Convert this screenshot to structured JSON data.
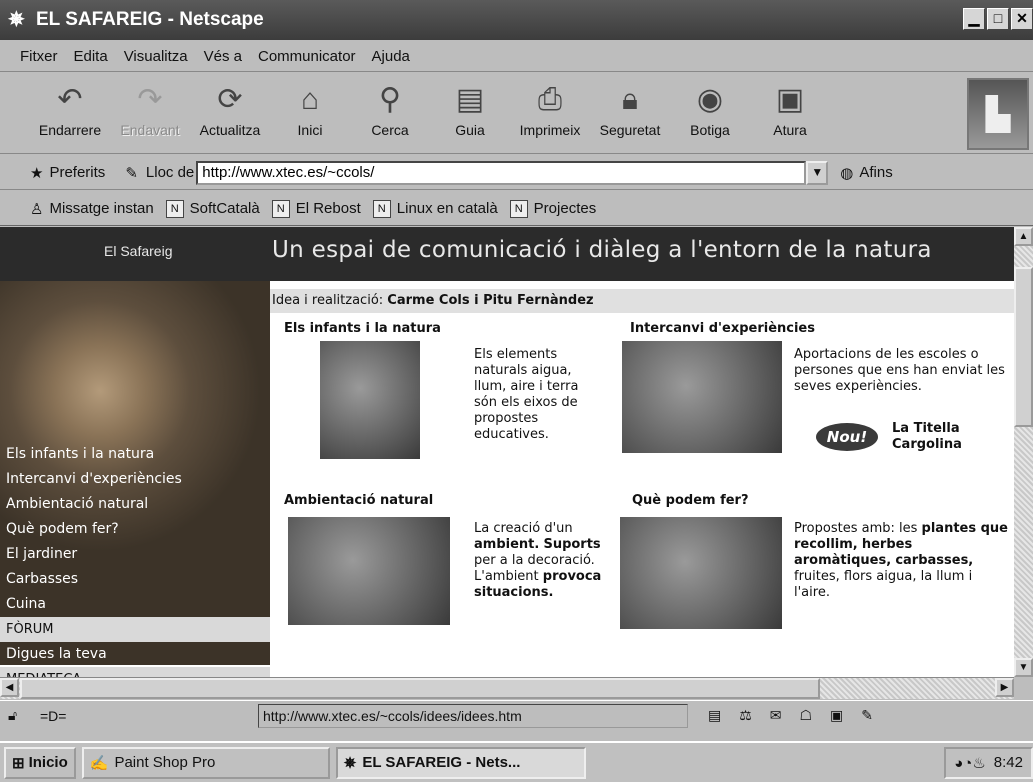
{
  "window": {
    "title": "EL SAFAREIG - Netscape"
  },
  "menu": [
    "Fitxer",
    "Edita",
    "Visualitza",
    "Vés a",
    "Communicator",
    "Ajuda"
  ],
  "toolbar": {
    "buttons": [
      "Endarrere",
      "Endavant",
      "Actualitza",
      "Inici",
      "Cerca",
      "Guia",
      "Imprimeix",
      "Seguretat",
      "Botiga",
      "Atura"
    ]
  },
  "location": {
    "bookmarks_label": "Preferits",
    "location_label": "Lloc de",
    "url": "http://www.xtec.es/~ccols/",
    "related_label": "Afins"
  },
  "personal_toolbar": [
    "Missatge instan",
    "SoftCatalà",
    "El Rebost",
    "Linux en català",
    "Projectes"
  ],
  "page": {
    "site_name": "El Safareig",
    "tagline": "Un espai de comunicació i diàleg a l'entorn de la natura",
    "credits_label": "Idea i realització:",
    "credits_names": "Carme Cols i Pitu Fernàndez",
    "nav": [
      "Els infants i la natura",
      "Intercanvi d'experiències",
      "Ambientació natural",
      "Què podem fer?",
      "El jardiner",
      "Carbasses",
      "Cuina",
      "FÒRUM",
      "Digues la teva",
      "MEDIATECA"
    ],
    "sections": [
      {
        "title": "Els infants i la natura",
        "text": "Els elements naturals aigua, llum, aire i terra són els eixos de propostes educatives."
      },
      {
        "title": "Intercanvi d'experiències",
        "text": "Aportacions de les escoles o persones que ens han enviat les seves experiències.",
        "badge": "Nou!",
        "extra": "La Titella Cargolina"
      },
      {
        "title": "Ambientació natural",
        "text_a": "La creació d'un",
        "bold_a": "ambient.",
        "bold_b": "Suports",
        "text_b": "per a la decoració. L'ambient",
        "bold_c": "provoca situacions."
      },
      {
        "title": "Què podem fer?",
        "text_a": "Propostes amb: les",
        "bold_a": "plantes que recollim,",
        "bold_b": "herbes aromàtiques,",
        "bold_c": "carbasses,",
        "text_b": "fruites, flors aigua, la llum i l'aire."
      }
    ]
  },
  "status": {
    "url": "http://www.xtec.es/~ccols/idees/idees.htm"
  },
  "taskbar": {
    "start": "Inicio",
    "tasks": [
      "Paint Shop Pro",
      "EL SAFAREIG - Nets..."
    ],
    "clock": "8:42"
  }
}
